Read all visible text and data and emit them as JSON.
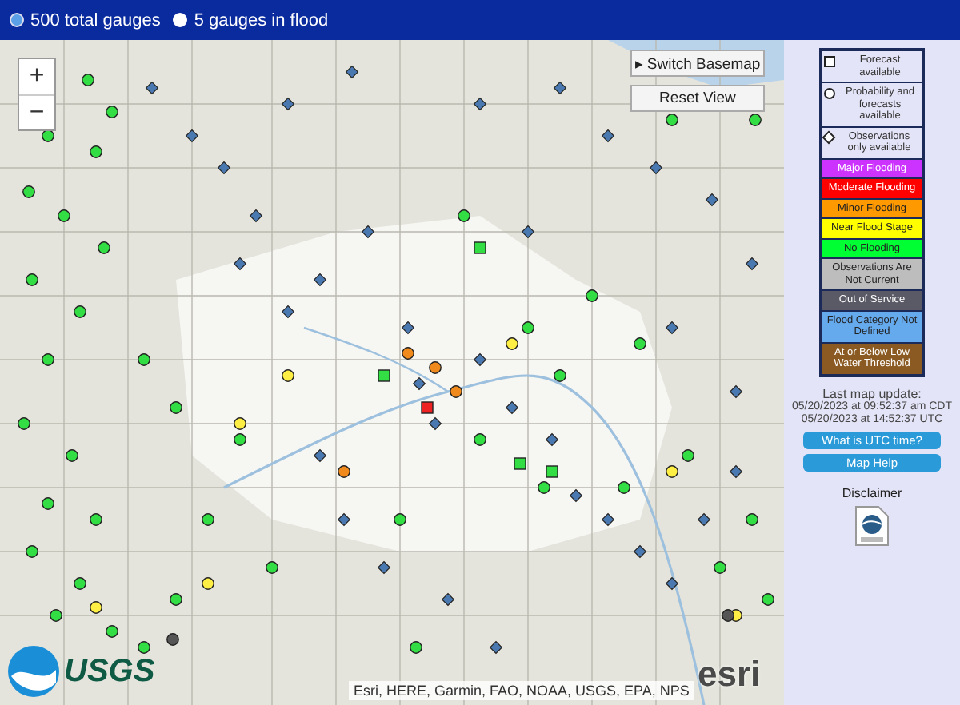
{
  "header": {
    "filters": [
      {
        "label": "500 total gauges",
        "selected": true
      },
      {
        "label": "5 gauges in flood",
        "selected": false
      }
    ]
  },
  "map": {
    "zoom_in": "+",
    "zoom_out": "−",
    "switch_basemap": {
      "arrow": "▸",
      "label": "Switch Basemap"
    },
    "reset_view": "Reset View",
    "usgs_logo": "USGS",
    "attribution": "Esri, HERE, Garmin, FAO, NOAA, USGS, EPA, NPS",
    "esri_logo": "esri"
  },
  "legend": [
    {
      "kind": "square",
      "label": "Forecast available"
    },
    {
      "kind": "circle",
      "label": "Probability and forecasts available"
    },
    {
      "kind": "diamond",
      "label": "Observations only available"
    },
    {
      "kind": "status",
      "label": "Major Flooding",
      "color": "#cc33ff"
    },
    {
      "kind": "status",
      "label": "Moderate Flooding",
      "color": "#ff0000"
    },
    {
      "kind": "status",
      "label": "Minor Flooding",
      "color": "#ff9900"
    },
    {
      "kind": "status",
      "label": "Near Flood Stage",
      "color": "#ffff00"
    },
    {
      "kind": "status",
      "label": "No Flooding",
      "color": "#00ff33"
    },
    {
      "kind": "status",
      "label": "Observations Are Not Current",
      "color": "#bdbdbd"
    },
    {
      "kind": "status",
      "label": "Out of Service",
      "color": "#5a5a66"
    },
    {
      "kind": "status",
      "label": "Flood Category Not Defined",
      "color": "#66aaee"
    },
    {
      "kind": "status",
      "label": "At or Below Low Water Threshold",
      "color": "#8b5a22"
    }
  ],
  "update": {
    "title": "Last map update:",
    "local_time": "05/20/2023 at 09:52:37 am CDT",
    "utc_time": "05/20/2023 at 14:52:37 UTC"
  },
  "buttons": [
    "What is UTC time?",
    "Map Help"
  ],
  "disclaimer": "Disclaimer"
}
